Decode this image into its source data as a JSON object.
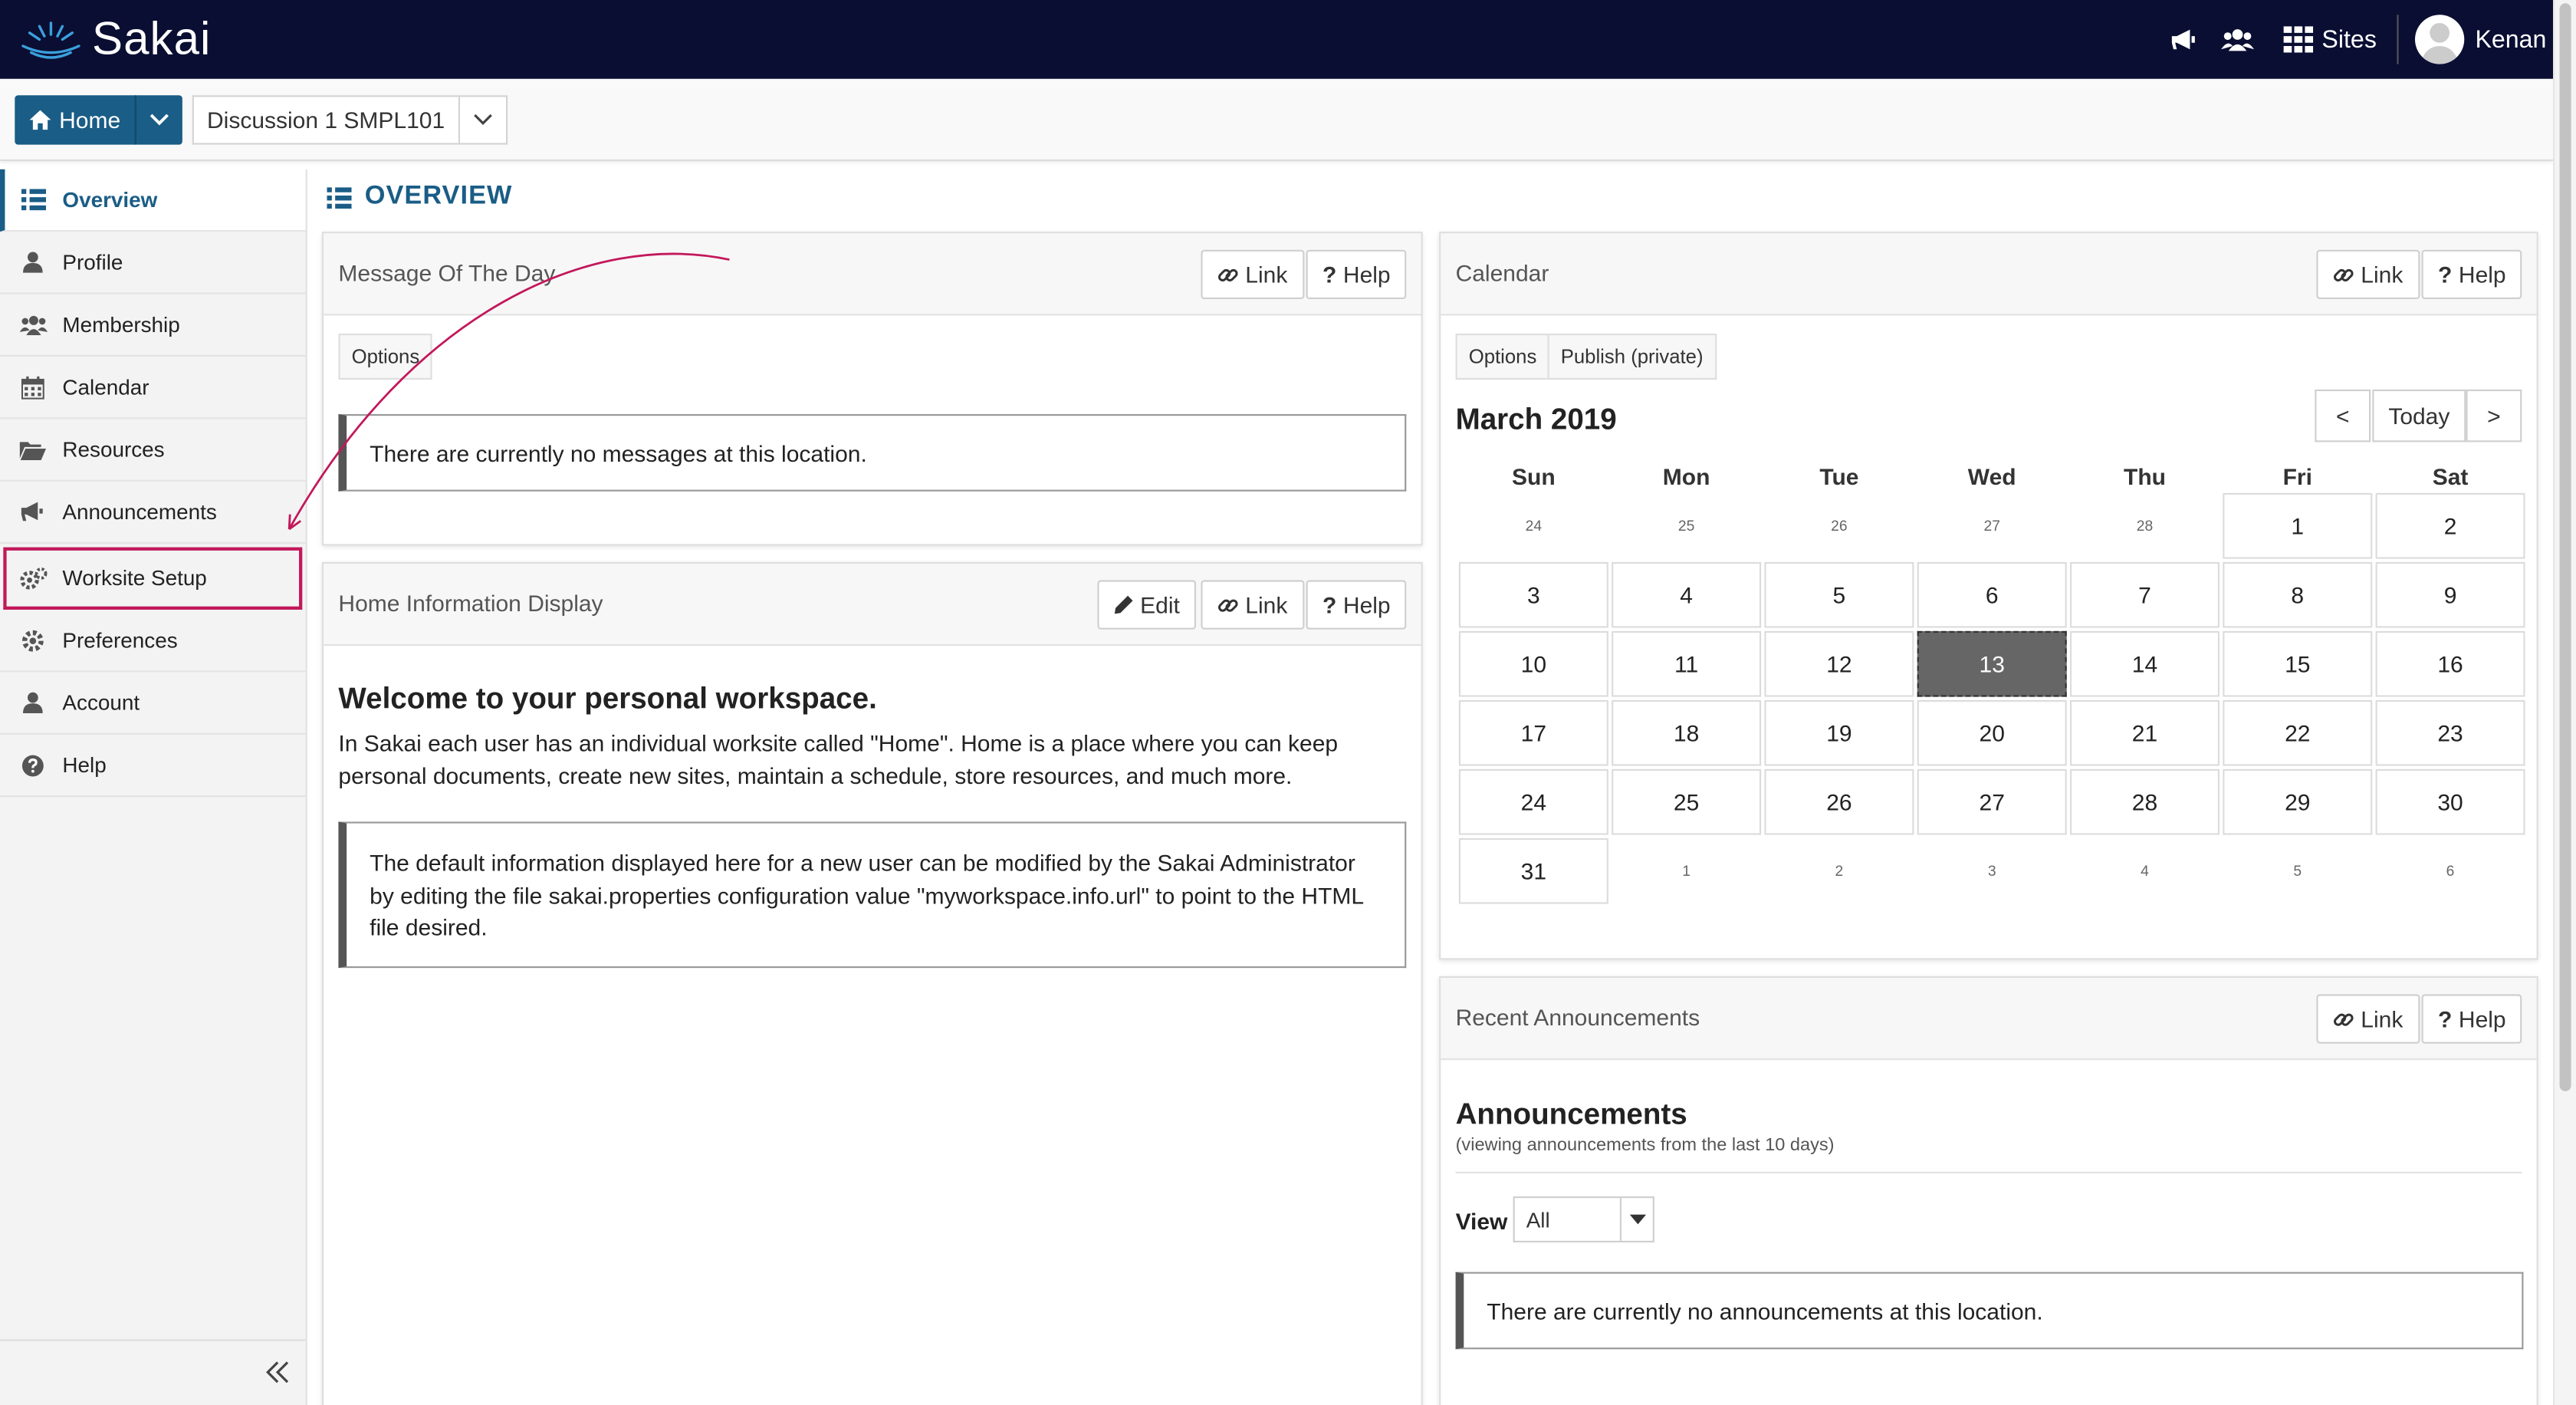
{
  "brand": {
    "name": "Sakai"
  },
  "topbar": {
    "sites_label": "Sites",
    "username": "Kenan"
  },
  "subnav": {
    "home_label": "Home",
    "site_label": "Discussion 1 SMPL101"
  },
  "sidebar": {
    "items": [
      {
        "label": "Overview",
        "icon": "list-icon"
      },
      {
        "label": "Profile",
        "icon": "user-icon"
      },
      {
        "label": "Membership",
        "icon": "users-icon"
      },
      {
        "label": "Calendar",
        "icon": "calendar-icon"
      },
      {
        "label": "Resources",
        "icon": "folder-open-icon"
      },
      {
        "label": "Announcements",
        "icon": "bullhorn-icon"
      },
      {
        "label": "Worksite Setup",
        "icon": "gears-icon"
      },
      {
        "label": "Preferences",
        "icon": "gear-icon"
      },
      {
        "label": "Account",
        "icon": "user-icon"
      },
      {
        "label": "Help",
        "icon": "question-circle-icon"
      }
    ],
    "highlighted": "Worksite Setup"
  },
  "page": {
    "title": "OVERVIEW"
  },
  "motd": {
    "title": "Message Of The Day",
    "link_label": "Link",
    "help_label": "Help",
    "options_label": "Options",
    "empty_message": "There are currently no messages at this location."
  },
  "home_info": {
    "title": "Home Information Display",
    "edit_label": "Edit",
    "link_label": "Link",
    "help_label": "Help",
    "heading": "Welcome to your personal workspace.",
    "paragraph": "In Sakai each user has an individual worksite called \"Home\". Home is a place where you can keep personal documents, create new sites, maintain a schedule, store resources, and much more.",
    "note": "The default information displayed here for a new user can be modified by the Sakai Administrator by editing the file sakai.properties configuration value \"myworkspace.info.url\" to point to the HTML file desired."
  },
  "calendar": {
    "title": "Calendar",
    "link_label": "Link",
    "help_label": "Help",
    "options_label": "Options",
    "publish_label": "Publish (private)",
    "month_label": "March 2019",
    "prev_label": "<",
    "today_label": "Today",
    "next_label": ">",
    "weekdays": [
      "Sun",
      "Mon",
      "Tue",
      "Wed",
      "Thu",
      "Fri",
      "Sat"
    ],
    "weeks": [
      [
        "24",
        "25",
        "26",
        "27",
        "28",
        "1",
        "2"
      ],
      [
        "3",
        "4",
        "5",
        "6",
        "7",
        "8",
        "9"
      ],
      [
        "10",
        "11",
        "12",
        "13",
        "14",
        "15",
        "16"
      ],
      [
        "17",
        "18",
        "19",
        "20",
        "21",
        "22",
        "23"
      ],
      [
        "24",
        "25",
        "26",
        "27",
        "28",
        "29",
        "30"
      ],
      [
        "31",
        "1",
        "2",
        "3",
        "4",
        "5",
        "6"
      ]
    ],
    "today": "13"
  },
  "announcements": {
    "title": "Recent Announcements",
    "link_label": "Link",
    "help_label": "Help",
    "heading": "Announcements",
    "subtitle": "(viewing announcements from the last 10 days)",
    "view_label": "View",
    "view_value": "All",
    "empty_message": "There are currently no announcements at this location."
  },
  "colors": {
    "topbar": "#0a0e32",
    "accent": "#1a5d86",
    "highlight": "#c2185b"
  }
}
